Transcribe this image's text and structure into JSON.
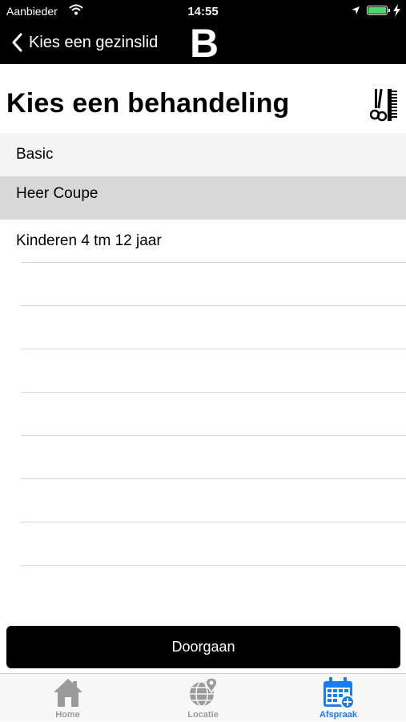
{
  "status_bar": {
    "carrier": "Aanbieder",
    "time": "14:55"
  },
  "nav": {
    "back_label": "Kies een gezinslid",
    "logo_letter": "B"
  },
  "header": {
    "title": "Kies een behandeling",
    "icon": "scissors-comb-icon"
  },
  "treatments": [
    {
      "label": "Basic"
    },
    {
      "label": "Heer Coupe",
      "selected": true
    },
    {
      "label": "Kinderen 4 tm 12 jaar"
    }
  ],
  "actions": {
    "continue_label": "Doorgaan"
  },
  "tab_bar": {
    "tabs": [
      {
        "label": "Home",
        "icon": "home-icon"
      },
      {
        "label": "Locatie",
        "icon": "globe-location-icon"
      },
      {
        "label": "Afspraak",
        "icon": "calendar-add-icon",
        "active": true
      }
    ]
  },
  "colors": {
    "accent": "#1a7cf0",
    "bar_background": "#000000",
    "selected_row": "#d8d8d8",
    "battery": "#4cd964"
  }
}
